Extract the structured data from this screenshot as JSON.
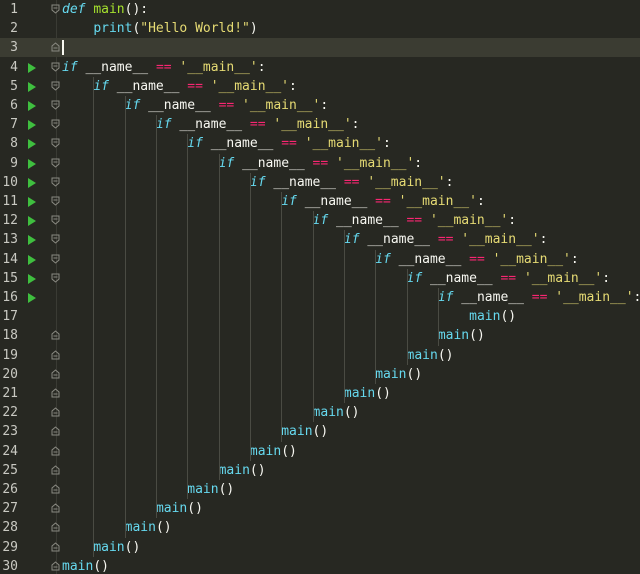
{
  "lines": [
    {
      "number": "1",
      "indent": 0,
      "fold": "open",
      "run": false,
      "tokens": [
        {
          "c": "kw",
          "t": "def"
        },
        {
          "c": "pl",
          "t": " "
        },
        {
          "c": "fn",
          "t": "main"
        },
        {
          "c": "pl",
          "t": "():"
        }
      ]
    },
    {
      "number": "2",
      "indent": 4,
      "fold": "",
      "run": false,
      "tokens": [
        {
          "c": "bi",
          "t": "print"
        },
        {
          "c": "pl",
          "t": "("
        },
        {
          "c": "str",
          "t": "\"Hello World!\""
        },
        {
          "c": "pl",
          "t": ")"
        }
      ]
    },
    {
      "number": "3",
      "indent": 0,
      "fold": "end",
      "run": false,
      "current": true,
      "tokens": []
    },
    {
      "number": "4",
      "indent": 0,
      "fold": "open",
      "run": true,
      "tokens": [
        {
          "c": "kw",
          "t": "if"
        },
        {
          "c": "pl",
          "t": " __name__ "
        },
        {
          "c": "op",
          "t": "=="
        },
        {
          "c": "pl",
          "t": " "
        },
        {
          "c": "str",
          "t": "'__main__'"
        },
        {
          "c": "pl",
          "t": ":"
        }
      ]
    },
    {
      "number": "5",
      "indent": 4,
      "fold": "open",
      "run": true,
      "tokens": [
        {
          "c": "kw",
          "t": "if"
        },
        {
          "c": "pl",
          "t": " __name__ "
        },
        {
          "c": "op",
          "t": "=="
        },
        {
          "c": "pl",
          "t": " "
        },
        {
          "c": "str",
          "t": "'__main__'"
        },
        {
          "c": "pl",
          "t": ":"
        }
      ]
    },
    {
      "number": "6",
      "indent": 8,
      "fold": "open",
      "run": true,
      "tokens": [
        {
          "c": "kw",
          "t": "if"
        },
        {
          "c": "pl",
          "t": " __name__ "
        },
        {
          "c": "op",
          "t": "=="
        },
        {
          "c": "pl",
          "t": " "
        },
        {
          "c": "str",
          "t": "'__main__'"
        },
        {
          "c": "pl",
          "t": ":"
        }
      ]
    },
    {
      "number": "7",
      "indent": 12,
      "fold": "open",
      "run": true,
      "tokens": [
        {
          "c": "kw",
          "t": "if"
        },
        {
          "c": "pl",
          "t": " __name__ "
        },
        {
          "c": "op",
          "t": "=="
        },
        {
          "c": "pl",
          "t": " "
        },
        {
          "c": "str",
          "t": "'__main__'"
        },
        {
          "c": "pl",
          "t": ":"
        }
      ]
    },
    {
      "number": "8",
      "indent": 16,
      "fold": "open",
      "run": true,
      "tokens": [
        {
          "c": "kw",
          "t": "if"
        },
        {
          "c": "pl",
          "t": " __name__ "
        },
        {
          "c": "op",
          "t": "=="
        },
        {
          "c": "pl",
          "t": " "
        },
        {
          "c": "str",
          "t": "'__main__'"
        },
        {
          "c": "pl",
          "t": ":"
        }
      ]
    },
    {
      "number": "9",
      "indent": 20,
      "fold": "open",
      "run": true,
      "tokens": [
        {
          "c": "kw",
          "t": "if"
        },
        {
          "c": "pl",
          "t": " __name__ "
        },
        {
          "c": "op",
          "t": "=="
        },
        {
          "c": "pl",
          "t": " "
        },
        {
          "c": "str",
          "t": "'__main__'"
        },
        {
          "c": "pl",
          "t": ":"
        }
      ]
    },
    {
      "number": "10",
      "indent": 24,
      "fold": "open",
      "run": true,
      "tokens": [
        {
          "c": "kw",
          "t": "if"
        },
        {
          "c": "pl",
          "t": " __name__ "
        },
        {
          "c": "op",
          "t": "=="
        },
        {
          "c": "pl",
          "t": " "
        },
        {
          "c": "str",
          "t": "'__main__'"
        },
        {
          "c": "pl",
          "t": ":"
        }
      ]
    },
    {
      "number": "11",
      "indent": 28,
      "fold": "open",
      "run": true,
      "tokens": [
        {
          "c": "kw",
          "t": "if"
        },
        {
          "c": "pl",
          "t": " __name__ "
        },
        {
          "c": "op",
          "t": "=="
        },
        {
          "c": "pl",
          "t": " "
        },
        {
          "c": "str",
          "t": "'__main__'"
        },
        {
          "c": "pl",
          "t": ":"
        }
      ]
    },
    {
      "number": "12",
      "indent": 32,
      "fold": "open",
      "run": true,
      "tokens": [
        {
          "c": "kw",
          "t": "if"
        },
        {
          "c": "pl",
          "t": " __name__ "
        },
        {
          "c": "op",
          "t": "=="
        },
        {
          "c": "pl",
          "t": " "
        },
        {
          "c": "str",
          "t": "'__main__'"
        },
        {
          "c": "pl",
          "t": ":"
        }
      ]
    },
    {
      "number": "13",
      "indent": 36,
      "fold": "open",
      "run": true,
      "tokens": [
        {
          "c": "kw",
          "t": "if"
        },
        {
          "c": "pl",
          "t": " __name__ "
        },
        {
          "c": "op",
          "t": "=="
        },
        {
          "c": "pl",
          "t": " "
        },
        {
          "c": "str",
          "t": "'__main__'"
        },
        {
          "c": "pl",
          "t": ":"
        }
      ]
    },
    {
      "number": "14",
      "indent": 40,
      "fold": "open",
      "run": true,
      "tokens": [
        {
          "c": "kw",
          "t": "if"
        },
        {
          "c": "pl",
          "t": " __name__ "
        },
        {
          "c": "op",
          "t": "=="
        },
        {
          "c": "pl",
          "t": " "
        },
        {
          "c": "str",
          "t": "'__main__'"
        },
        {
          "c": "pl",
          "t": ":"
        }
      ]
    },
    {
      "number": "15",
      "indent": 44,
      "fold": "open",
      "run": true,
      "tokens": [
        {
          "c": "kw",
          "t": "if"
        },
        {
          "c": "pl",
          "t": " __name__ "
        },
        {
          "c": "op",
          "t": "=="
        },
        {
          "c": "pl",
          "t": " "
        },
        {
          "c": "str",
          "t": "'__main__'"
        },
        {
          "c": "pl",
          "t": ":"
        }
      ]
    },
    {
      "number": "16",
      "indent": 48,
      "fold": "",
      "run": true,
      "tokens": [
        {
          "c": "kw",
          "t": "if"
        },
        {
          "c": "pl",
          "t": " __name__ "
        },
        {
          "c": "op",
          "t": "=="
        },
        {
          "c": "pl",
          "t": " "
        },
        {
          "c": "str",
          "t": "'__main__'"
        },
        {
          "c": "pl",
          "t": ":"
        }
      ]
    },
    {
      "number": "17",
      "indent": 52,
      "fold": "",
      "run": false,
      "tokens": [
        {
          "c": "bi",
          "t": "main"
        },
        {
          "c": "pl",
          "t": "()"
        }
      ]
    },
    {
      "number": "18",
      "indent": 48,
      "fold": "end",
      "run": false,
      "tokens": [
        {
          "c": "bi",
          "t": "main"
        },
        {
          "c": "pl",
          "t": "()"
        }
      ]
    },
    {
      "number": "19",
      "indent": 44,
      "fold": "end",
      "run": false,
      "tokens": [
        {
          "c": "bi",
          "t": "main"
        },
        {
          "c": "pl",
          "t": "()"
        }
      ]
    },
    {
      "number": "20",
      "indent": 40,
      "fold": "end",
      "run": false,
      "tokens": [
        {
          "c": "bi",
          "t": "main"
        },
        {
          "c": "pl",
          "t": "()"
        }
      ]
    },
    {
      "number": "21",
      "indent": 36,
      "fold": "end",
      "run": false,
      "tokens": [
        {
          "c": "bi",
          "t": "main"
        },
        {
          "c": "pl",
          "t": "()"
        }
      ]
    },
    {
      "number": "22",
      "indent": 32,
      "fold": "end",
      "run": false,
      "tokens": [
        {
          "c": "bi",
          "t": "main"
        },
        {
          "c": "pl",
          "t": "()"
        }
      ]
    },
    {
      "number": "23",
      "indent": 28,
      "fold": "end",
      "run": false,
      "tokens": [
        {
          "c": "bi",
          "t": "main"
        },
        {
          "c": "pl",
          "t": "()"
        }
      ]
    },
    {
      "number": "24",
      "indent": 24,
      "fold": "end",
      "run": false,
      "tokens": [
        {
          "c": "bi",
          "t": "main"
        },
        {
          "c": "pl",
          "t": "()"
        }
      ]
    },
    {
      "number": "25",
      "indent": 20,
      "fold": "end",
      "run": false,
      "tokens": [
        {
          "c": "bi",
          "t": "main"
        },
        {
          "c": "pl",
          "t": "()"
        }
      ]
    },
    {
      "number": "26",
      "indent": 16,
      "fold": "end",
      "run": false,
      "tokens": [
        {
          "c": "bi",
          "t": "main"
        },
        {
          "c": "pl",
          "t": "()"
        }
      ]
    },
    {
      "number": "27",
      "indent": 12,
      "fold": "end",
      "run": false,
      "tokens": [
        {
          "c": "bi",
          "t": "main"
        },
        {
          "c": "pl",
          "t": "()"
        }
      ]
    },
    {
      "number": "28",
      "indent": 8,
      "fold": "end",
      "run": false,
      "tokens": [
        {
          "c": "bi",
          "t": "main"
        },
        {
          "c": "pl",
          "t": "()"
        }
      ]
    },
    {
      "number": "29",
      "indent": 4,
      "fold": "end",
      "run": false,
      "tokens": [
        {
          "c": "bi",
          "t": "main"
        },
        {
          "c": "pl",
          "t": "()"
        }
      ]
    },
    {
      "number": "30",
      "indent": 0,
      "fold": "end",
      "run": false,
      "tokens": [
        {
          "c": "bi",
          "t": "main"
        },
        {
          "c": "pl",
          "t": "()"
        }
      ]
    }
  ],
  "colors": {
    "background": "#272822",
    "current_line": "#3b3c32",
    "keyword": "#66d9ef",
    "function": "#a6e22e",
    "operator": "#f92672",
    "string": "#e6db74",
    "text": "#f8f8f2",
    "run_marker": "#3fbf3f"
  }
}
